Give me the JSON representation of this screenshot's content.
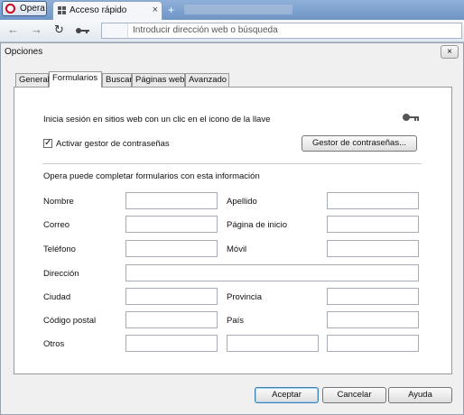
{
  "browser": {
    "menu_label": "Opera",
    "tab_title": "Acceso rápido",
    "tab_close": "×",
    "new_tab": "+",
    "address_placeholder": "Introducir dirección web o búsqueda",
    "nav_back": "←",
    "nav_forward": "→",
    "nav_reload": "↻"
  },
  "dialog": {
    "title": "Opciones",
    "close_label": "×",
    "tabs": [
      "General",
      "Formularios",
      "Buscar",
      "Páginas web",
      "Avanzado"
    ],
    "active_tab": "Formularios",
    "login_text": "Inicia sesión en sitios web con un clic en el icono de la llave",
    "password_manager_checkbox": "Activar gestor de contraseñas",
    "password_manager_checked": true,
    "password_manager_button": "Gestor de contraseñas...",
    "forms_heading": "Opera puede completar formularios con esta información",
    "fields": {
      "nombre": {
        "label": "Nombre",
        "value": ""
      },
      "apellido": {
        "label": "Apellido",
        "value": ""
      },
      "correo": {
        "label": "Correo",
        "value": ""
      },
      "pagina_inicio": {
        "label": "Página de inicio",
        "value": ""
      },
      "telefono": {
        "label": "Teléfono",
        "value": ""
      },
      "movil": {
        "label": "Móvil",
        "value": ""
      },
      "direccion": {
        "label": "Dirección",
        "value": ""
      },
      "ciudad": {
        "label": "Ciudad",
        "value": ""
      },
      "provincia": {
        "label": "Provincia",
        "value": ""
      },
      "codigo_postal": {
        "label": "Código postal",
        "value": ""
      },
      "pais": {
        "label": "País",
        "value": ""
      },
      "otros": {
        "label": "Otros",
        "value1": "",
        "value2": "",
        "value3": ""
      }
    },
    "buttons": {
      "accept": "Aceptar",
      "cancel": "Cancelar",
      "help": "Ayuda"
    }
  }
}
